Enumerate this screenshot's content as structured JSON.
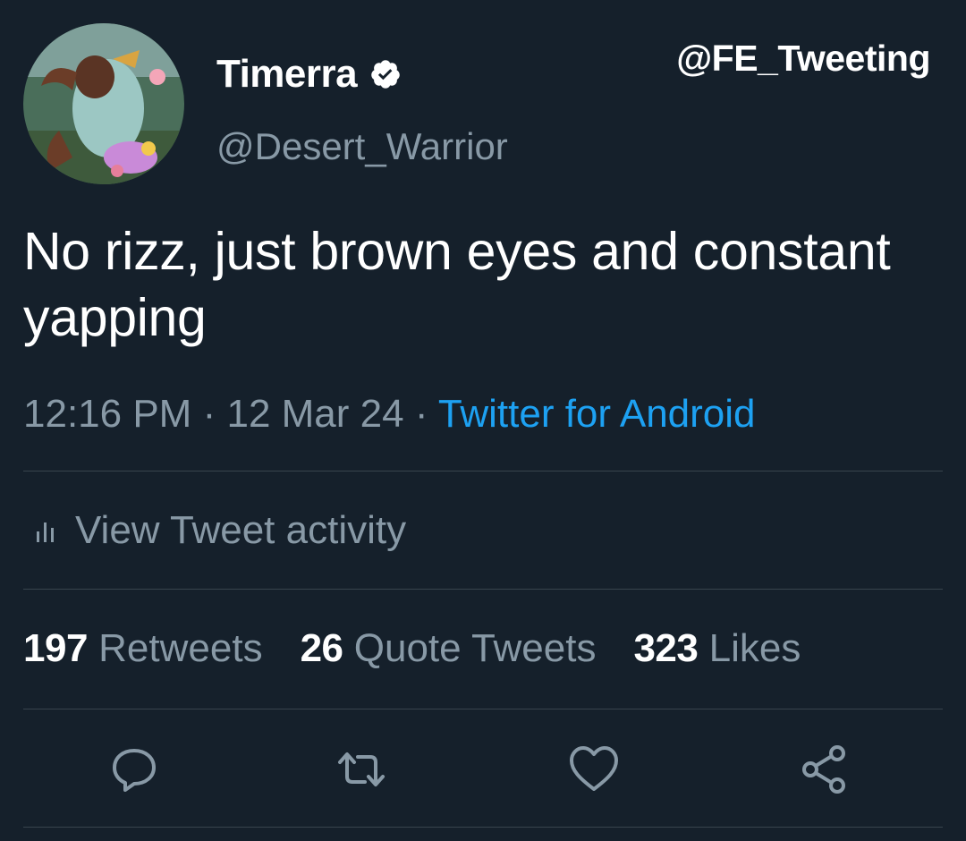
{
  "watermark": "@FE_Tweeting",
  "author": {
    "display_name": "Timerra",
    "handle": "@Desert_Warrior",
    "verified_icon": "verified-badge-icon"
  },
  "tweet": {
    "text": "No rizz, just brown eyes and constant yapping",
    "time": "12:16 PM",
    "separator": "·",
    "date": "12 Mar 24",
    "source": "Twitter for Android"
  },
  "activity": {
    "label": "View Tweet activity",
    "icon": "bar-chart-icon"
  },
  "stats": [
    {
      "count": "197",
      "label": "Retweets"
    },
    {
      "count": "26",
      "label": "Quote Tweets"
    },
    {
      "count": "323",
      "label": "Likes"
    }
  ],
  "actions": [
    {
      "name": "reply",
      "icon": "reply-icon"
    },
    {
      "name": "retweet",
      "icon": "retweet-icon"
    },
    {
      "name": "like",
      "icon": "heart-icon"
    },
    {
      "name": "share",
      "icon": "share-icon"
    }
  ],
  "colors": {
    "background": "#15202b",
    "text_primary": "#ffffff",
    "text_secondary": "#8899a6",
    "link": "#1da1f2",
    "divider": "#38444d"
  }
}
